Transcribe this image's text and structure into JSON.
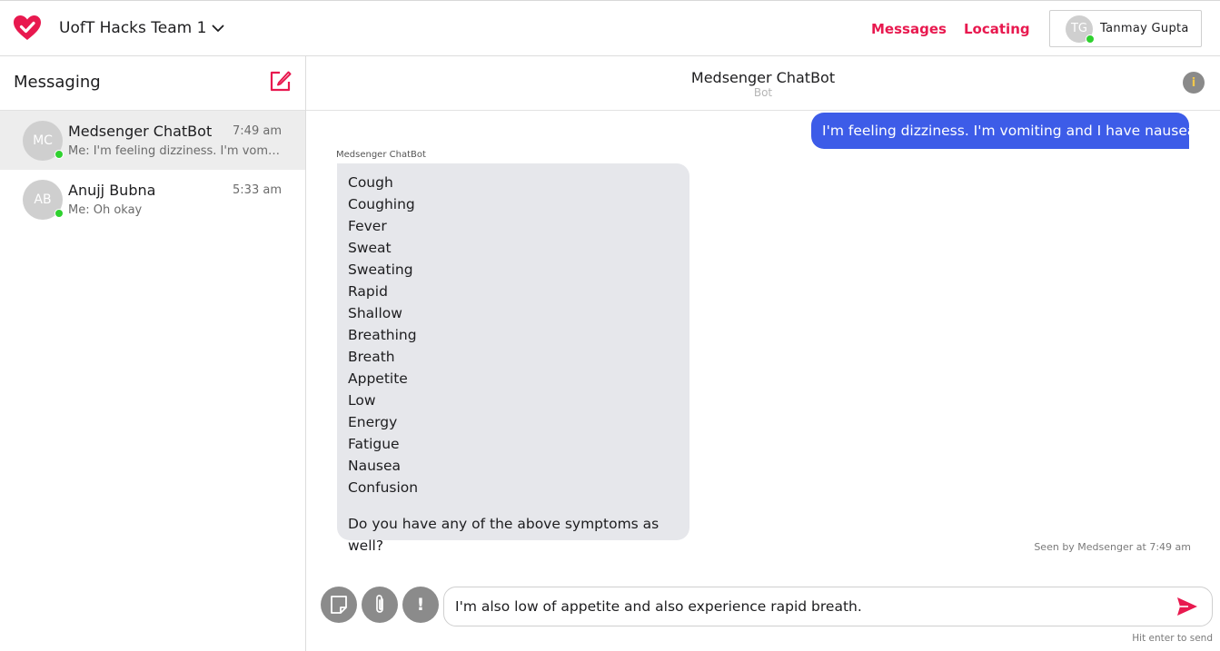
{
  "colors": {
    "accent": "#e8194f",
    "my_bubble": "#3d5ce8",
    "bot_bubble": "#e6e7eb",
    "online": "#2fd12f",
    "avatar": "#cfcfcf"
  },
  "header": {
    "logo_icon": "heart-check-icon",
    "team_name": "UofT Hacks Team 1",
    "nav": {
      "messages": "Messages",
      "locating": "Locating"
    },
    "user": {
      "initials": "TG",
      "name": "Tanmay Gupta"
    }
  },
  "sidebar": {
    "title": "Messaging",
    "compose_icon": "compose-icon",
    "conversations": [
      {
        "initials": "MC",
        "name": "Medsenger ChatBot",
        "time": "7:49 am",
        "preview": "Me: I'm feeling dizziness. I'm vomiting and I have nausea.",
        "active": true
      },
      {
        "initials": "AB",
        "name": "Anujj Bubna",
        "time": "5:33 am",
        "preview": "Me: Oh okay",
        "active": false
      }
    ]
  },
  "chat": {
    "name": "Medsenger ChatBot",
    "subtitle": "Bot",
    "info_icon": "info-icon",
    "messages": {
      "user_message": "I'm feeling dizziness. I'm vomiting and I have nausea.",
      "bot_sender": "Medsenger ChatBot",
      "bot_symptoms": [
        "Cough",
        "Coughing",
        "Fever",
        "Sweat",
        "Sweating",
        "Rapid",
        "Shallow",
        "Breathing",
        "Breath",
        "Appetite",
        "Low",
        "Energy",
        "Fatigue",
        "Nausea",
        "Confusion"
      ],
      "bot_question": "Do you have any of the above symptoms as well?"
    },
    "seen_text": "Seen by Medsenger at 7:49 am",
    "composer": {
      "value": "I'm also low of appetite and also experience rapid breath.",
      "hint": "Hit enter to send",
      "alert_glyph": "!"
    }
  }
}
